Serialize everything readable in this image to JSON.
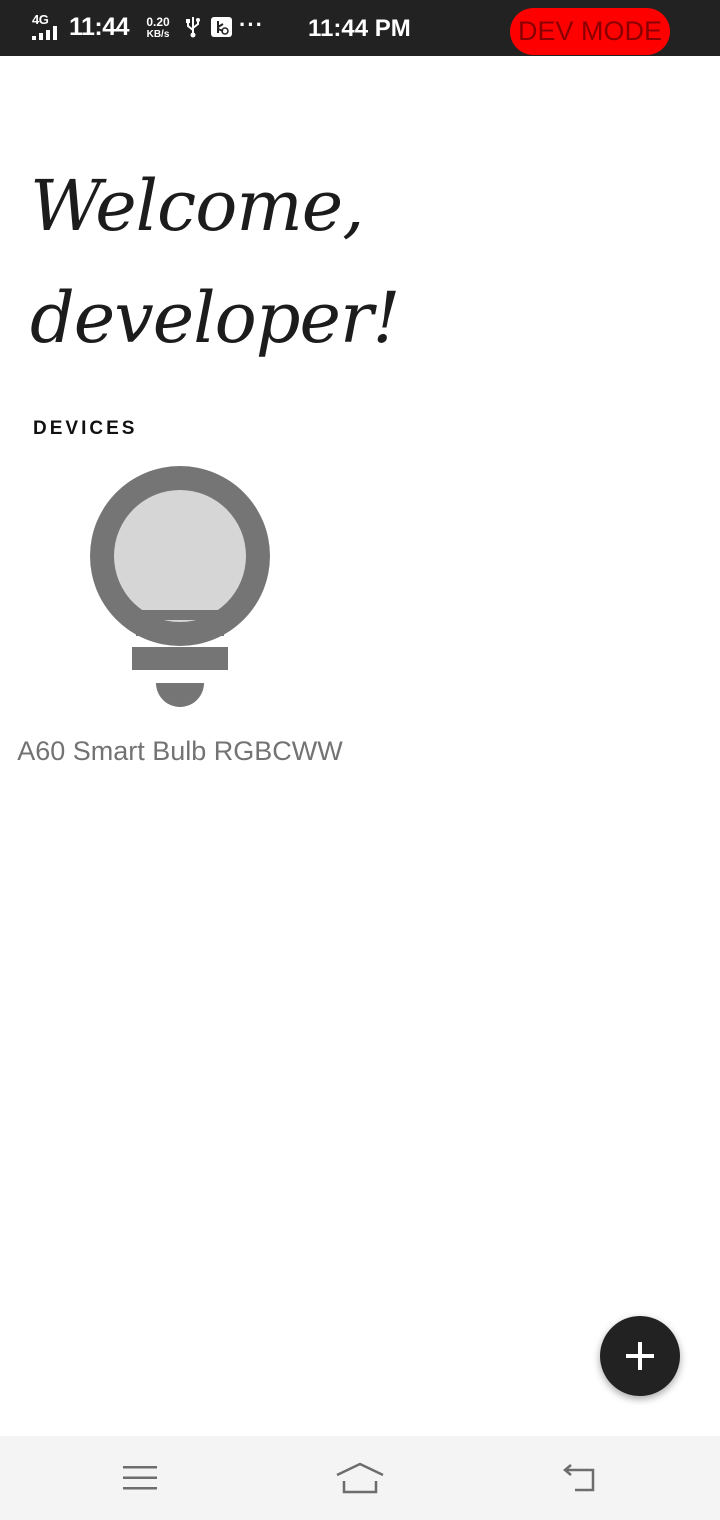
{
  "status_bar": {
    "network": "4G",
    "time": "11:44",
    "speed_value": "0.20",
    "speed_unit": "KB/s",
    "more": "···",
    "clock": "11:44 PM",
    "icons": [
      "signal-icon",
      "usb-icon",
      "app-notification-icon"
    ]
  },
  "dev_badge": {
    "label": "DEV MODE",
    "color": "#ff0000"
  },
  "welcome": {
    "line1": "Welcome,",
    "line2": "developer!"
  },
  "devices": {
    "title": "DEVICES",
    "items": [
      {
        "name": "A60 Smart Bulb RGBCWW",
        "icon": "lightbulb-icon"
      }
    ]
  },
  "fab": {
    "icon": "plus-icon"
  },
  "nav_bar": {
    "buttons": [
      {
        "icon": "menu-icon"
      },
      {
        "icon": "home-icon"
      },
      {
        "icon": "back-icon"
      }
    ]
  },
  "colors": {
    "status_bar_bg": "#222222",
    "bulb_dark": "#757575",
    "bulb_light": "#d6d6d6",
    "fab_bg": "#222222",
    "nav_bg": "#f4f4f4"
  }
}
